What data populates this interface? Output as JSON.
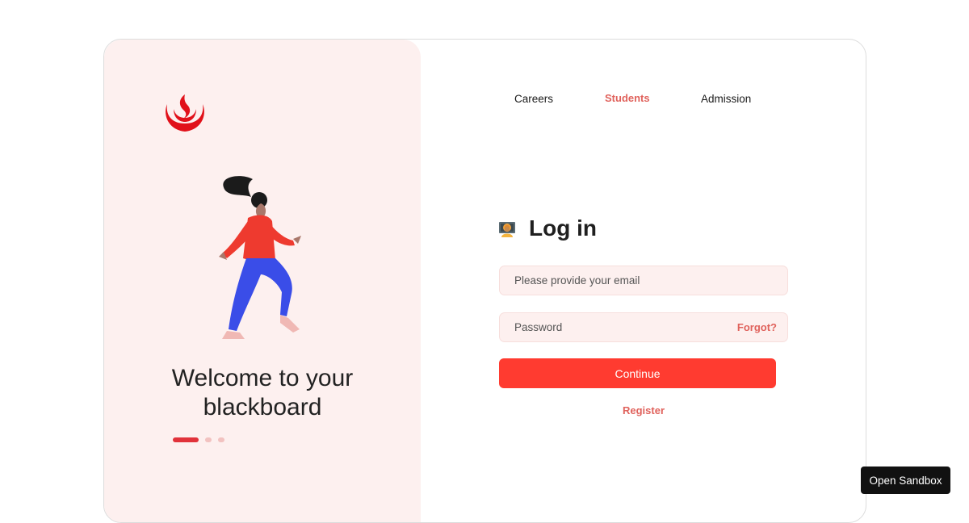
{
  "brand": {
    "logo_icon": "flame-logo-icon",
    "accent_color": "#e1323a"
  },
  "hero": {
    "welcome_text": "Welcome to your blackboard",
    "illustration": "running-woman-illustration",
    "carousel": {
      "total": 3,
      "active": 1
    }
  },
  "nav": {
    "items": [
      {
        "label": "Careers",
        "active": false
      },
      {
        "label": "Students",
        "active": true
      },
      {
        "label": "Admission",
        "active": false
      }
    ]
  },
  "login": {
    "icon": "teacher-emoji-icon",
    "title": "Log in",
    "email": {
      "placeholder": "Please provide your email",
      "value": ""
    },
    "password": {
      "placeholder": "Password",
      "value": ""
    },
    "forgot_label": "Forgot?",
    "continue_label": "Continue",
    "register_label": "Register",
    "button_color": "#ff3b30"
  },
  "sandbox": {
    "label": "Open Sandbox"
  }
}
